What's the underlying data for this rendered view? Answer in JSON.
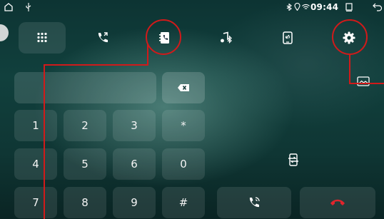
{
  "status": {
    "time": "09:44"
  },
  "toolbar": [
    {
      "name": "dialpad-icon",
      "active": true
    },
    {
      "name": "call-log-icon"
    },
    {
      "name": "contacts-icon"
    },
    {
      "name": "bluetooth-music-icon"
    },
    {
      "name": "phone-link-icon"
    },
    {
      "name": "settings-icon"
    }
  ],
  "dialpad": {
    "keys": [
      "1",
      "2",
      "3",
      "*",
      "4",
      "5",
      "6",
      "0",
      "7",
      "8",
      "9",
      "#"
    ]
  },
  "colors": {
    "annotation": "#d11a1a",
    "hangup": "#e0252c"
  }
}
